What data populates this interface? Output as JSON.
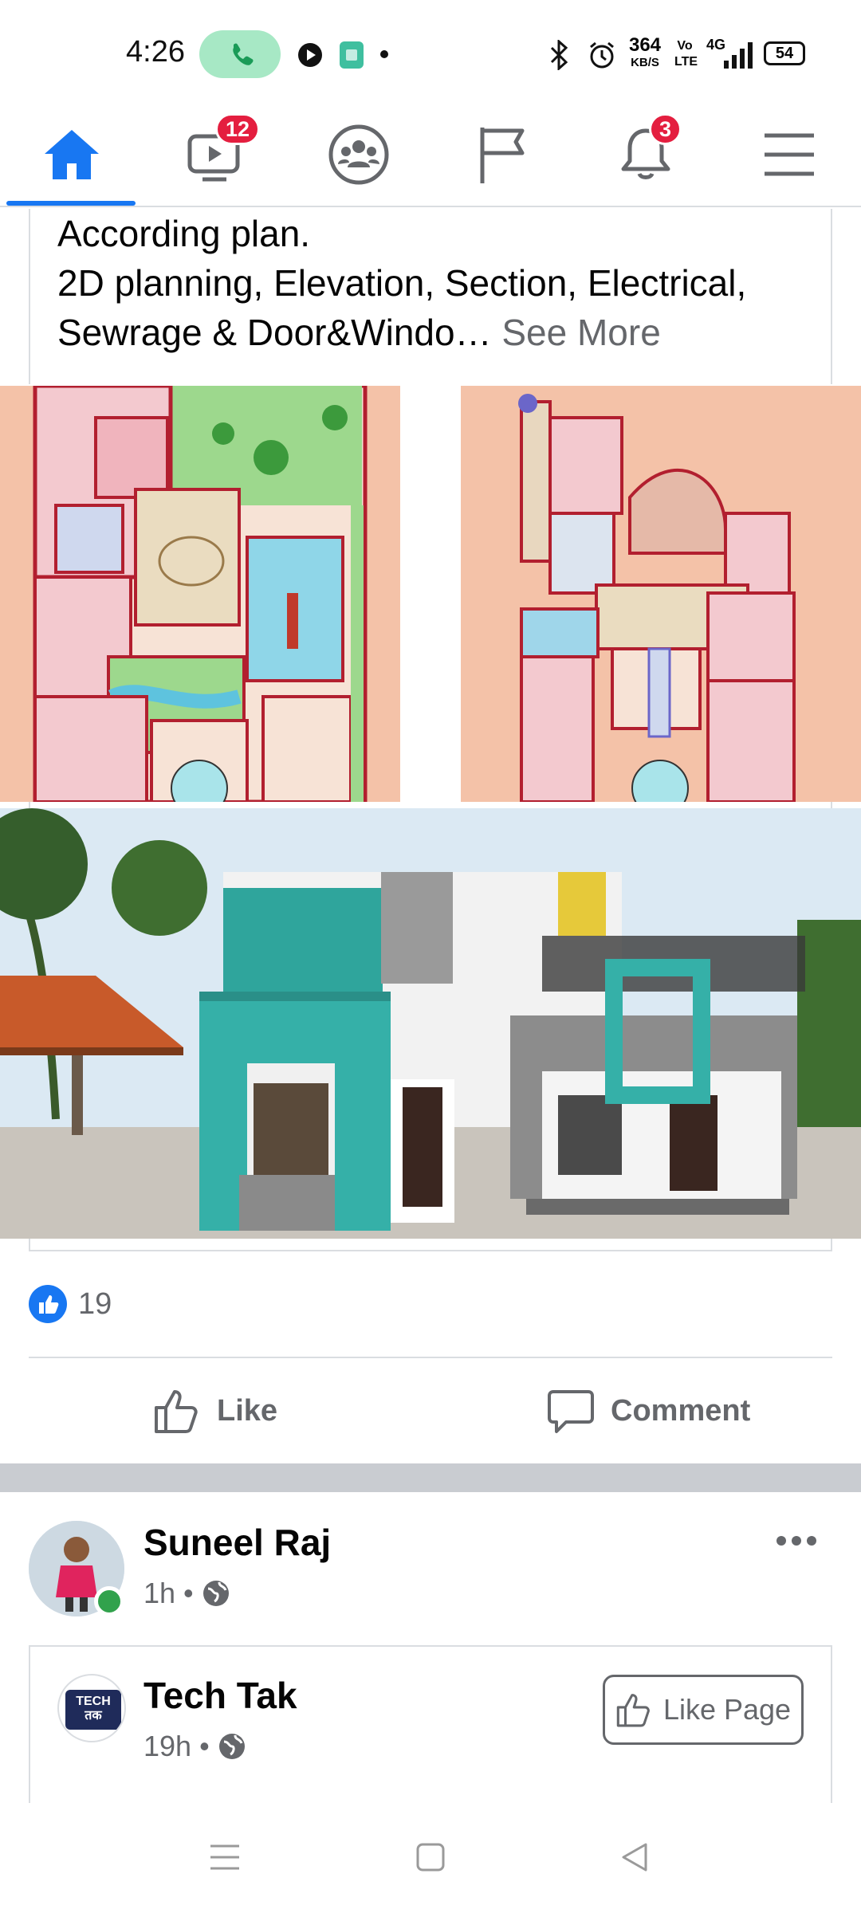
{
  "status_bar": {
    "time": "4:26",
    "speed_value": "364",
    "speed_unit": "KB/S",
    "volte": "Vo LTE",
    "network": "4G",
    "battery": "54"
  },
  "nav": {
    "video_badge": "12",
    "notification_badge": "3"
  },
  "post": {
    "text_line1": "According plan.",
    "text_line2": "2D planning, Elevation, Section, Electrical,",
    "text_line3": "Sewrage & Door&Windo…",
    "see_more": "See More",
    "likes_count": "19",
    "like_label": "Like",
    "comment_label": "Comment"
  },
  "next_post": {
    "author": "Suneel Raj",
    "time": "1h",
    "shared_page": "Tech Tak",
    "shared_time": "19h",
    "like_page_label": "Like Page",
    "logo_text_top": "TECH",
    "logo_text_bottom": "तक"
  },
  "colors": {
    "brand_blue": "#1877f2",
    "badge_red": "#e41e3f",
    "secondary_text": "#65676b",
    "online_green": "#31a24c"
  }
}
